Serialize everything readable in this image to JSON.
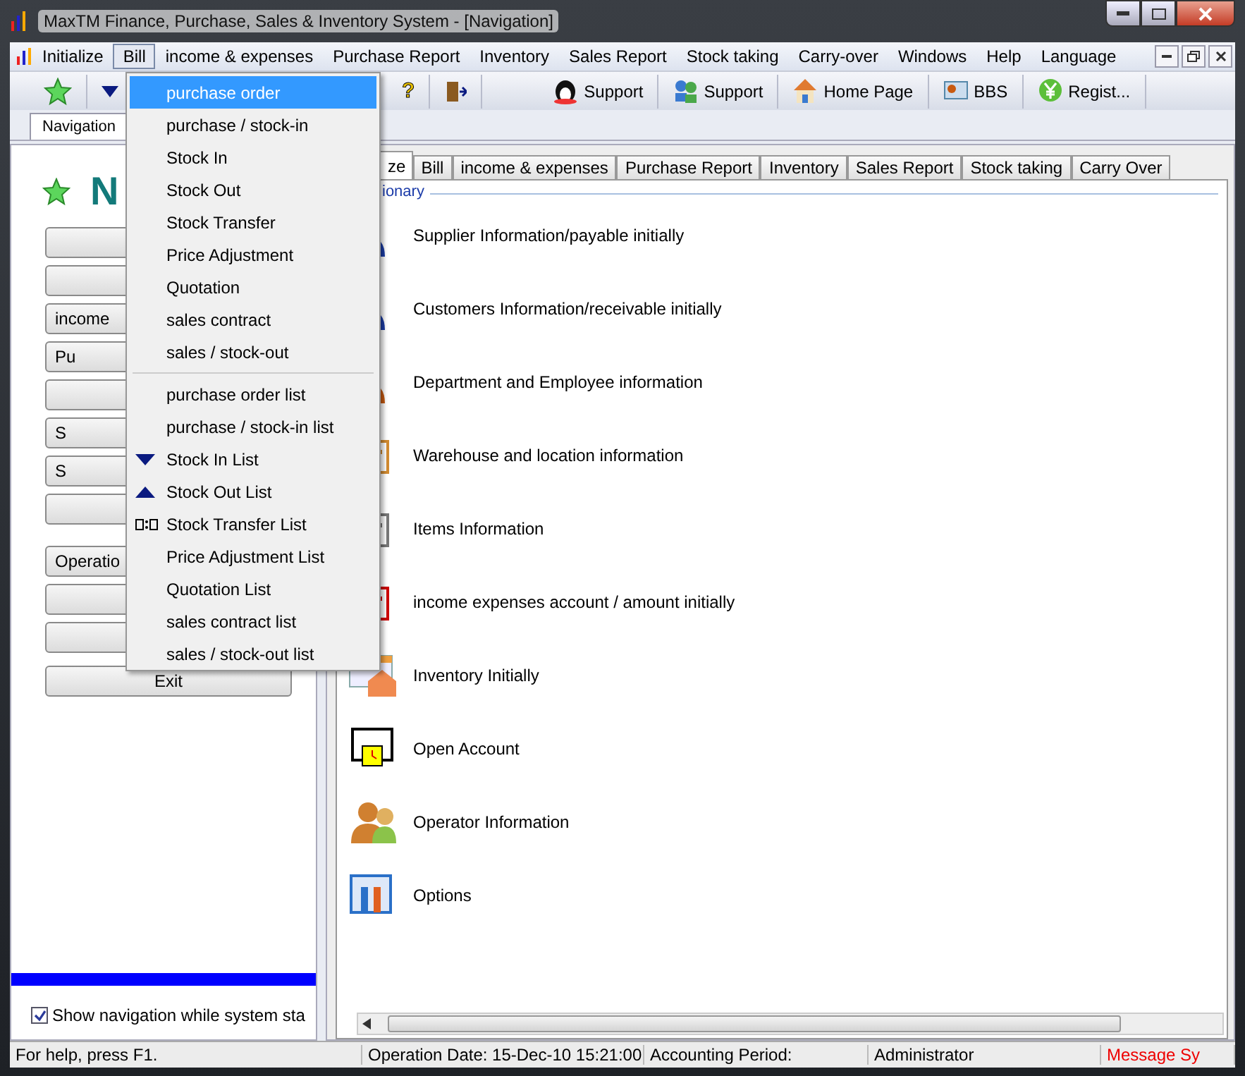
{
  "window": {
    "title": "MaxTM Finance, Purchase, Sales & Inventory System - [Navigation]"
  },
  "menubar": [
    {
      "label": "Initialize",
      "selected": false
    },
    {
      "label": "Bill",
      "selected": true
    },
    {
      "label": "income & expenses",
      "selected": false
    },
    {
      "label": "Purchase Report",
      "selected": false
    },
    {
      "label": "Inventory",
      "selected": false
    },
    {
      "label": "Sales Report",
      "selected": false
    },
    {
      "label": "Stock taking",
      "selected": false
    },
    {
      "label": "Carry-over",
      "selected": false
    },
    {
      "label": "Windows",
      "selected": false
    },
    {
      "label": "Help",
      "selected": false
    },
    {
      "label": "Language",
      "selected": false
    }
  ],
  "help_glyph": "?",
  "toolbar": [
    {
      "label": "Support"
    },
    {
      "label": "Support"
    },
    {
      "label": "Home Page"
    },
    {
      "label": "BBS"
    },
    {
      "label": "Regist..."
    }
  ],
  "doc_tabs": [
    {
      "label": "Navigation",
      "selected": true
    }
  ],
  "bill_menu": [
    {
      "label": "purchase order",
      "kind": "plain",
      "selected": true
    },
    {
      "label": "purchase / stock-in",
      "kind": "plain",
      "selected": false
    },
    {
      "label": "Stock In",
      "kind": "plain",
      "selected": false
    },
    {
      "label": "Stock Out",
      "kind": "plain",
      "selected": false
    },
    {
      "label": "Stock Transfer",
      "kind": "plain",
      "selected": false
    },
    {
      "label": "Price Adjustment",
      "kind": "plain",
      "selected": false
    },
    {
      "label": "Quotation",
      "kind": "plain",
      "selected": false
    },
    {
      "label": "sales contract",
      "kind": "plain",
      "selected": false
    },
    {
      "label": "sales / stock-out",
      "kind": "plain",
      "selected": false
    },
    {
      "label": "purchase order list",
      "kind": "plain",
      "selected": false,
      "separator_before": true
    },
    {
      "label": "purchase / stock-in list",
      "kind": "plain",
      "selected": false
    },
    {
      "label": "Stock In List",
      "kind": "down",
      "selected": false
    },
    {
      "label": "Stock Out List",
      "kind": "up",
      "selected": false
    },
    {
      "label": "Stock Transfer List",
      "kind": "transfer",
      "selected": false
    },
    {
      "label": "Price Adjustment List",
      "kind": "plain",
      "selected": false
    },
    {
      "label": "Quotation List",
      "kind": "plain",
      "selected": false
    },
    {
      "label": "sales contract list",
      "kind": "plain",
      "selected": false
    },
    {
      "label": "sales / stock-out list",
      "kind": "plain",
      "selected": false
    }
  ],
  "navigation": {
    "title": "N",
    "buttons": [
      {
        "kind": "blank"
      },
      {
        "kind": "blank"
      },
      {
        "kind": "labeled",
        "label": "income"
      },
      {
        "kind": "labeled",
        "label": "Pu"
      },
      {
        "kind": "blank"
      },
      {
        "kind": "labeled",
        "label": "S"
      },
      {
        "kind": "labeled",
        "label": "S"
      },
      {
        "kind": "blank"
      }
    ],
    "buttons_2": [
      {
        "kind": "labeled",
        "label": "Operatio"
      },
      {
        "kind": "blank"
      },
      {
        "kind": "blank"
      }
    ],
    "exit_button": "Exit",
    "show_on_start": {
      "label": "Show navigation while system sta",
      "checked": true
    }
  },
  "tabs": [
    {
      "label": "ze",
      "selected": true
    },
    {
      "label": "Bill",
      "selected": false
    },
    {
      "label": "income & expenses",
      "selected": false
    },
    {
      "label": "Purchase Report",
      "selected": false
    },
    {
      "label": "Inventory",
      "selected": false
    },
    {
      "label": "Sales Report",
      "selected": false
    },
    {
      "label": "Stock taking",
      "selected": false
    },
    {
      "label": "Carry Over",
      "selected": false
    }
  ],
  "group": {
    "legend": "ionary",
    "items": [
      "Supplier Information/payable initially",
      "Customers Information/receivable initially",
      "Department and Employee information",
      "Warehouse and location information",
      "Items Information",
      "income  expenses account / amount initially",
      "Inventory Initially",
      "Open Account",
      "Operator Information",
      "Options"
    ]
  },
  "status_bar": [
    "For help, press F1.",
    "Operation Date: 15-Dec-10 15:21:00",
    "Accounting Period:",
    "Administrator",
    "Message Sy"
  ]
}
